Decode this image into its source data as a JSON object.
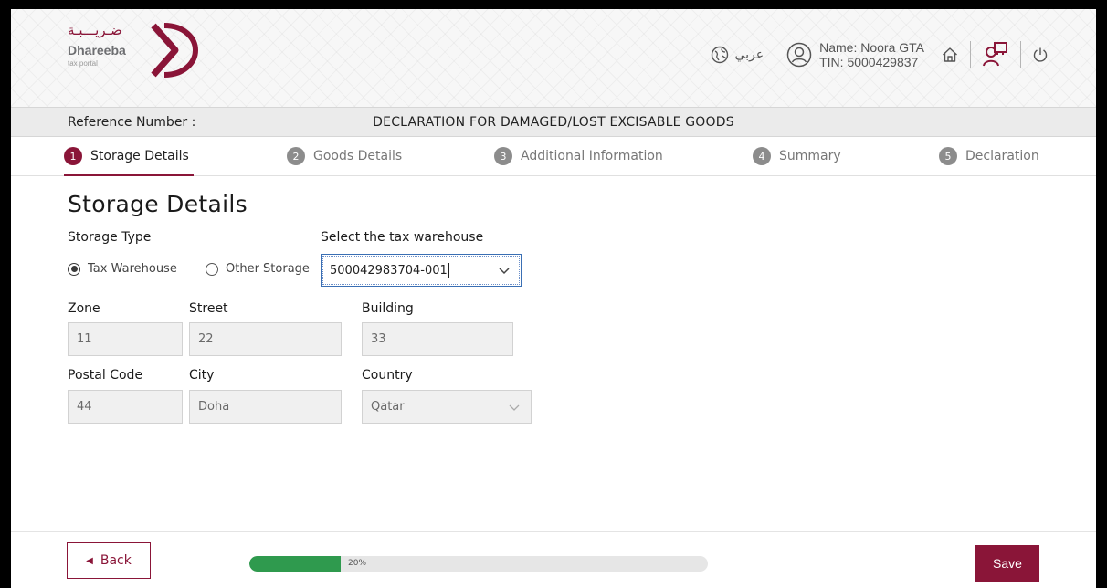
{
  "header": {
    "logo_arabic": "ضـريـــبـة",
    "logo_english": "Dhareeba",
    "logo_sub": "tax portal",
    "language_label": "عربي",
    "user_name": "Name: Noora GTA",
    "user_tin": "TIN: 5000429837",
    "icons": [
      "globe-icon",
      "user-icon",
      "home-icon",
      "users-icon",
      "power-icon"
    ]
  },
  "titlebar": {
    "reference_label": "Reference Number :",
    "declaration_title": "DECLARATION FOR DAMAGED/LOST EXCISABLE GOODS"
  },
  "steps": [
    {
      "num": "1",
      "label": "Storage Details",
      "active": true
    },
    {
      "num": "2",
      "label": "Goods Details",
      "active": false
    },
    {
      "num": "3",
      "label": "Additional Information",
      "active": false
    },
    {
      "num": "4",
      "label": "Summary",
      "active": false
    },
    {
      "num": "5",
      "label": "Declaration",
      "active": false
    }
  ],
  "form": {
    "page_title": "Storage Details",
    "storage_type_label": "Storage Type",
    "option_tax_warehouse": "Tax Warehouse",
    "option_other_storage": "Other Storage",
    "selected_storage_type": "Tax Warehouse",
    "warehouse_label": "Select the tax warehouse",
    "warehouse_value": "500042983704-001",
    "zone_label": "Zone",
    "zone_value": "11",
    "street_label": "Street",
    "street_value": "22",
    "building_label": "Building",
    "building_value": "33",
    "postal_code_label": "Postal Code",
    "postal_code_value": "44",
    "city_label": "City",
    "city_value": "Doha",
    "country_label": "Country",
    "country_value": "Qatar"
  },
  "footer": {
    "back_label": "Back",
    "progress_percent": 20,
    "progress_text": "20%",
    "save_label": "Save"
  },
  "colors": {
    "brand": "#8a1538",
    "progress": "#2f9a4e",
    "step_inactive": "#8c8c8c"
  }
}
